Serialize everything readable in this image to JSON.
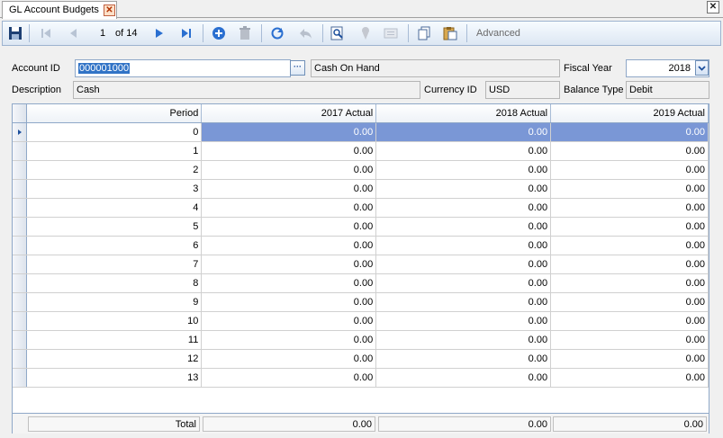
{
  "tab": {
    "title": "GL Account Budgets",
    "close_glyph": "✕"
  },
  "window": {
    "close_glyph": "✕"
  },
  "toolbar": {
    "record_position": "1",
    "record_total": "of 14",
    "advanced_label": "Advanced"
  },
  "form": {
    "account_id_label": "Account ID",
    "account_id_value": "000001000",
    "account_name_value": "Cash On Hand",
    "browse_glyph": "···",
    "fiscal_year_label": "Fiscal Year",
    "fiscal_year_value": "2018",
    "description_label": "Description",
    "description_value": "Cash",
    "currency_id_label": "Currency ID",
    "currency_id_value": "USD",
    "balance_type_label": "Balance Type",
    "balance_type_value": "Debit"
  },
  "grid": {
    "columns": [
      "Period",
      "2017 Actual",
      "2018 Actual",
      "2019 Actual"
    ],
    "rows": [
      [
        "0",
        "0.00",
        "0.00",
        "0.00"
      ],
      [
        "1",
        "0.00",
        "0.00",
        "0.00"
      ],
      [
        "2",
        "0.00",
        "0.00",
        "0.00"
      ],
      [
        "3",
        "0.00",
        "0.00",
        "0.00"
      ],
      [
        "4",
        "0.00",
        "0.00",
        "0.00"
      ],
      [
        "5",
        "0.00",
        "0.00",
        "0.00"
      ],
      [
        "6",
        "0.00",
        "0.00",
        "0.00"
      ],
      [
        "7",
        "0.00",
        "0.00",
        "0.00"
      ],
      [
        "8",
        "0.00",
        "0.00",
        "0.00"
      ],
      [
        "9",
        "0.00",
        "0.00",
        "0.00"
      ],
      [
        "10",
        "0.00",
        "0.00",
        "0.00"
      ],
      [
        "11",
        "0.00",
        "0.00",
        "0.00"
      ],
      [
        "12",
        "0.00",
        "0.00",
        "0.00"
      ],
      [
        "13",
        "0.00",
        "0.00",
        "0.00"
      ]
    ],
    "totals": [
      "Total",
      "0.00",
      "0.00",
      "0.00"
    ]
  },
  "colors": {
    "selection": "#7a97d6",
    "toolbar_border": "#9db3cf",
    "accent_blue": "#1c4f9c"
  }
}
